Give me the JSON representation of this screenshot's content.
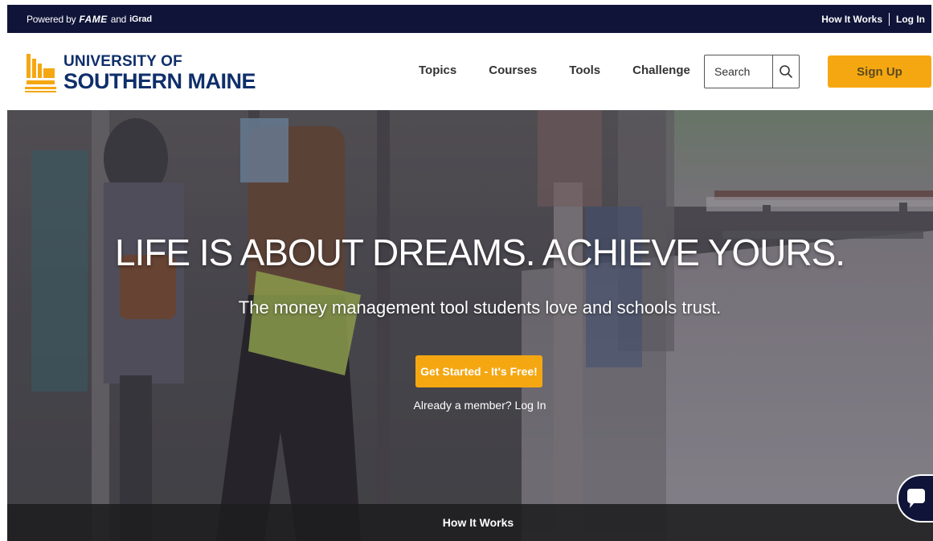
{
  "topbar": {
    "powered_by": "Powered by",
    "brand_fame": "FAME",
    "and": "and",
    "brand_igrad": "iGrad",
    "how_it_works": "How It Works",
    "log_in": "Log In"
  },
  "header": {
    "logo_line1": "UNIVERSITY OF",
    "logo_line2": "SOUTHERN MAINE",
    "nav": [
      "Topics",
      "Courses",
      "Tools",
      "Challenge"
    ],
    "search_placeholder": "Search",
    "sign_up": "Sign Up"
  },
  "hero": {
    "title": "LIFE IS ABOUT DREAMS. ACHIEVE YOURS.",
    "subtitle": "The money management tool students love and schools trust.",
    "cta": "Get Started - It's Free!",
    "member_text": "Already a member? Log In",
    "how_it_works": "How It Works"
  },
  "colors": {
    "navy": "#0f1438",
    "accent": "#f5a712",
    "logo_blue": "#0f2f6b",
    "logo_gold": "#f5a712"
  },
  "icons": {
    "search": "search-icon",
    "chat": "chat-icon",
    "logo": "usm-logo-icon"
  }
}
